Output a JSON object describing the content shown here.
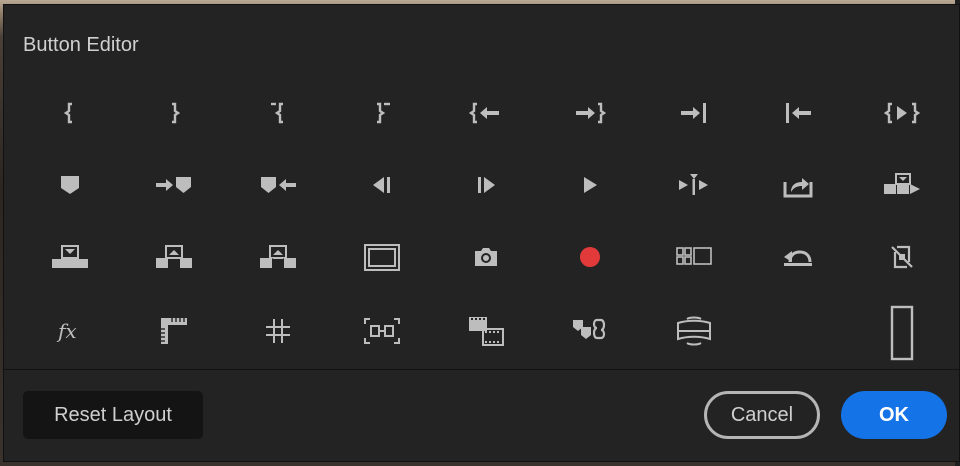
{
  "dialog": {
    "title": "Button Editor"
  },
  "icons": [
    "marker-in-bracket-icon",
    "marker-out-bracket-icon",
    "clear-in-icon",
    "clear-out-icon",
    "go-to-in-icon",
    "go-to-out-icon",
    "step-forward-edit-icon",
    "step-back-edit-icon",
    "play-in-to-out-icon",
    "add-marker-icon",
    "go-to-next-marker-icon",
    "go-to-previous-marker-icon",
    "step-back-icon",
    "step-forward-icon",
    "play-icon",
    "play-around-icon",
    "export-frame-icon",
    "insert-icon",
    "overwrite-icon",
    "lift-icon",
    "extract-icon",
    "safe-margins-icon",
    "camera-icon",
    "record-icon",
    "multi-camera-icon",
    "loop-playback-icon",
    "toggle-proxies-icon",
    "fx-icon",
    "ruler-icon",
    "grid-lines-icon",
    "trim-icon",
    "film-frames-icon",
    "markers-link-icon",
    "vr-video-icon",
    "spacer-icon"
  ],
  "accent_color": "#1473e6",
  "record_color": "#e23a3a",
  "footer": {
    "reset_label": "Reset Layout",
    "cancel_label": "Cancel",
    "ok_label": "OK"
  }
}
